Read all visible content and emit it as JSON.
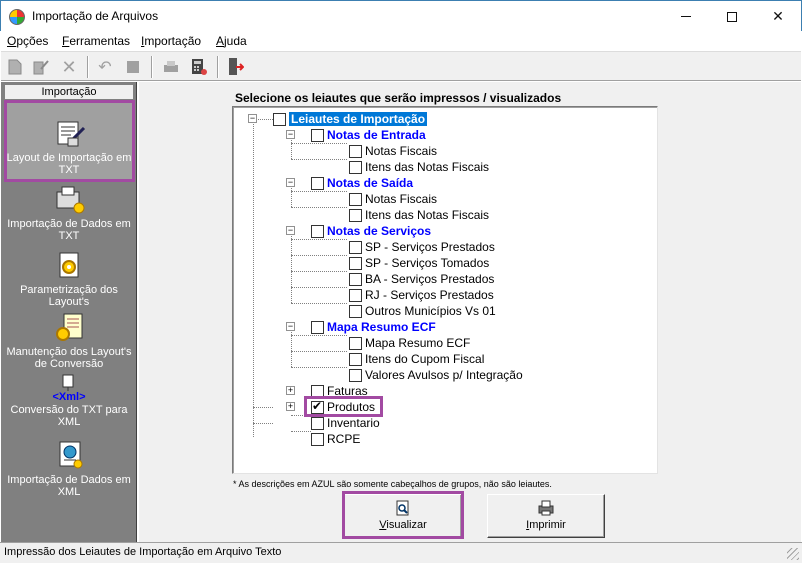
{
  "window": {
    "title": "Importação de Arquivos"
  },
  "menu": [
    {
      "label": "Opções",
      "ul": "O",
      "rest": "pções"
    },
    {
      "label": "Ferramentas",
      "ul": "F",
      "rest": "erramentas"
    },
    {
      "label": "Importação",
      "ul": "I",
      "rest": "mportação"
    },
    {
      "label": "Ajuda",
      "ul": "A",
      "rest": "juda"
    }
  ],
  "sidebar": {
    "header": "Importação",
    "items": [
      {
        "label": "Layout de Importação em TXT",
        "icon": "layout-import-icon",
        "selected": true
      },
      {
        "label": "Importação de Dados em TXT",
        "icon": "data-import-icon",
        "selected": false
      },
      {
        "label": "Parametrização dos Layout's",
        "icon": "parameters-icon",
        "selected": false
      },
      {
        "label": "Manutenção dos Layout's de Conversão",
        "icon": "maintenance-icon",
        "selected": false
      },
      {
        "label": "Conversão do TXT para XML",
        "icon": "xml-icon",
        "selected": false,
        "badge": "<Xml>"
      },
      {
        "label": "Importação de Dados em XML",
        "icon": "xml-import-icon",
        "selected": false
      }
    ]
  },
  "main": {
    "title": "Selecione os leiautes que serão impressos / visualizados",
    "footnote": "* As descrições em AZUL são somente cabeçalhos de grupos, não são leiautes.",
    "tree": {
      "root": "Leiautes de Importação",
      "n_entrada": "Notas de Entrada",
      "n_entrada_1": "Notas Fiscais",
      "n_entrada_2": "Itens das Notas Fiscais",
      "n_saida": "Notas de Saída",
      "n_saida_1": "Notas Fiscais",
      "n_saida_2": "Itens das Notas Fiscais",
      "n_servicos": "Notas de Serviços",
      "n_servicos_1": "SP - Serviços Prestados",
      "n_servicos_2": "SP - Serviços Tomados",
      "n_servicos_3": "BA - Serviços Prestados",
      "n_servicos_4": "RJ - Serviços Prestados",
      "n_servicos_5": "Outros Municípios Vs 01",
      "mapa": "Mapa Resumo ECF",
      "mapa_1": "Mapa Resumo ECF",
      "mapa_2": "Itens do Cupom Fiscal",
      "mapa_3": "Valores Avulsos p/ Integração",
      "faturas": "Faturas",
      "produtos": "Produtos",
      "inventario": "Inventario",
      "rcpe": "RCPE"
    },
    "buttons": {
      "visualizar": {
        "ul": "V",
        "rest": "isualizar"
      },
      "imprimir": {
        "ul": "I",
        "rest": "mprimir"
      }
    }
  },
  "status": {
    "text": "Impressão dos Leiautes de Importação em Arquivo Texto"
  },
  "colors": {
    "group_header": "#0000ff",
    "highlight": "#a24aa2",
    "selection": "#0078d7"
  }
}
